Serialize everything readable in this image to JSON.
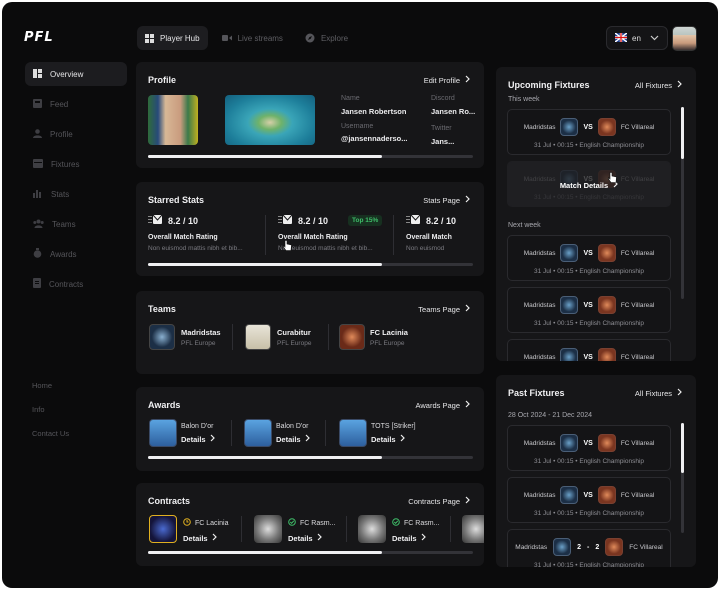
{
  "app": {
    "logo": "PFL"
  },
  "topnav": [
    {
      "label": "Player Hub",
      "icon": "grid-icon",
      "active": true
    },
    {
      "label": "Live streams",
      "icon": "video-icon",
      "active": false
    },
    {
      "label": "Explore",
      "icon": "compass-icon",
      "active": false
    }
  ],
  "lang": {
    "code": "en",
    "flag": "uk-flag-icon"
  },
  "sidebar": {
    "items": [
      {
        "label": "Overview",
        "active": true
      },
      {
        "label": "Feed"
      },
      {
        "label": "Profile"
      },
      {
        "label": "Fixtures"
      },
      {
        "label": "Stats"
      },
      {
        "label": "Teams"
      },
      {
        "label": "Awards"
      },
      {
        "label": "Contracts"
      }
    ],
    "footer": [
      "Home",
      "Info",
      "Contact Us"
    ]
  },
  "profile": {
    "title": "Profile",
    "link": "Edit Profile",
    "name_label": "Name",
    "name": "Jansen Robertson",
    "username_label": "Username",
    "username": "@jansennaderso...",
    "discord_label": "Discord",
    "discord": "Jansen Ro...",
    "twitter_label": "Twitter",
    "twitter": "Jans...",
    "scroll_fraction": 0.72
  },
  "stats": {
    "title": "Starred Stats",
    "link": "Stats Page",
    "items": [
      {
        "value": "8.2 / 10",
        "name": "Overall Match Rating",
        "desc": "Non euismod mattis nibh et bib..."
      },
      {
        "value": "8.2 / 10",
        "badge": "Top 15%",
        "name": "Overall Match Rating",
        "desc": "Non euismod mattis nibh et bib..."
      },
      {
        "value": "8.2 / 10",
        "name": "Overall Match",
        "desc": "Non euismod"
      }
    ],
    "scroll_fraction": 0.72
  },
  "teams": {
    "title": "Teams",
    "link": "Teams Page",
    "items": [
      {
        "name": "Madridstas",
        "league": "PFL Europe"
      },
      {
        "name": "Curabitur",
        "league": "PFL Europe"
      },
      {
        "name": "FC Lacinia",
        "league": "PFL Europe"
      }
    ]
  },
  "awards": {
    "title": "Awards",
    "link": "Awards Page",
    "items": [
      {
        "name": "Balon D'or",
        "action": "Details"
      },
      {
        "name": "Balon D'or",
        "action": "Details"
      },
      {
        "name": "TOTS [Striker]",
        "action": "Details"
      }
    ],
    "scroll_fraction": 0.72
  },
  "contracts": {
    "title": "Contracts",
    "link": "Contracts Page",
    "items": [
      {
        "name": "FC Lacinia",
        "action": "Details"
      },
      {
        "name": "FC Rasm...",
        "action": "Details"
      },
      {
        "name": "FC Rasm...",
        "action": "Details"
      }
    ],
    "scroll_fraction": 0.72
  },
  "upcoming": {
    "title": "Upcoming Fixtures",
    "link": "All Fixtures",
    "this_week": "This week",
    "next_week": "Next week",
    "home": "Madridstas",
    "vs": "VS",
    "away": "FC Villareal",
    "date": "31 Jul  •  00:15  •  English Championship",
    "hover_action": "Match Details"
  },
  "past": {
    "title": "Past Fixtures",
    "link": "All Fixtures",
    "range": "28 Oct 2024  -  21 Dec 2024",
    "home": "Madridstas",
    "vs": "VS",
    "away": "FC Villareal",
    "date": "31 Jul  •  00:15  •  English Championship",
    "score_home": "2",
    "score_sep": "-",
    "score_away": "2"
  },
  "colors": {
    "bg": "#0b0b0c",
    "card": "#161618",
    "accent_green": "#3fbf6a",
    "contract_highlight": "#e0b020"
  }
}
